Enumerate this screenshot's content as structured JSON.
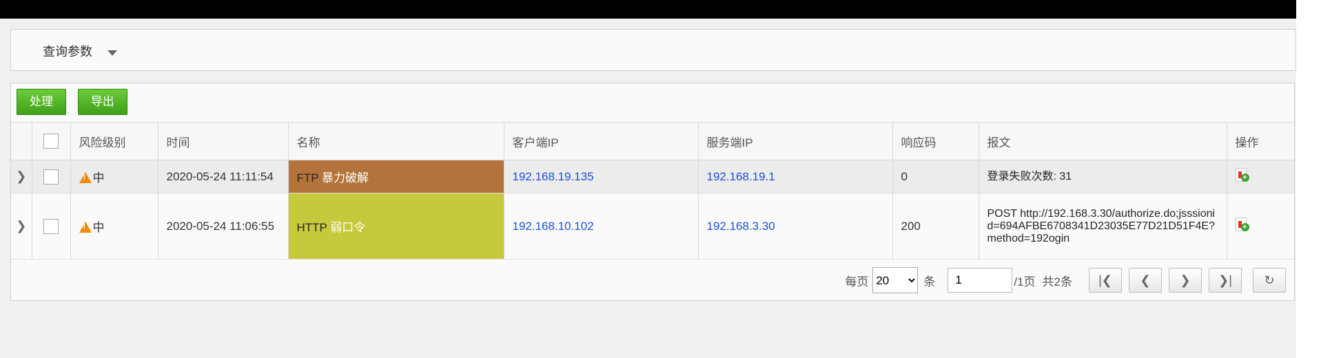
{
  "query": {
    "title": "查询参数"
  },
  "toolbar": {
    "process_label": "处理",
    "export_label": "导出"
  },
  "table": {
    "headers": [
      "风险级别",
      "时间",
      "名称",
      "客户端IP",
      "服务端IP",
      "响应码",
      "报文",
      "操作"
    ],
    "rows": [
      {
        "risk": "中",
        "time": "2020-05-24 11:11:54",
        "name_prefix": "FTP",
        "name_suffix": " 暴力破解",
        "name_color": "#b4733a",
        "client_ip": "192.168.19.135",
        "server_ip": "192.168.19.1",
        "code": "0",
        "report": "登录失败次数: 31"
      },
      {
        "risk": "中",
        "time": "2020-05-24 11:06:55",
        "name_prefix": "HTTP",
        "name_suffix": " 弱口令",
        "name_color": "#c7c93c",
        "client_ip": "192.168.10.102",
        "server_ip": "192.168.3.30",
        "code": "200",
        "report": "POST http://192.168.3.30/authorize.do;jsssionid=694AFBE6708341D23035E77D21D51F4E?method=192ogin"
      }
    ]
  },
  "pager": {
    "per_page_label": "每页",
    "per_page_value": "20",
    "unit_label": "条",
    "page_input": "1",
    "total_pages_label": "/1页",
    "total_label": "共2条"
  },
  "colors": {
    "accent": "#4caf21",
    "link": "#1d4fd8"
  }
}
